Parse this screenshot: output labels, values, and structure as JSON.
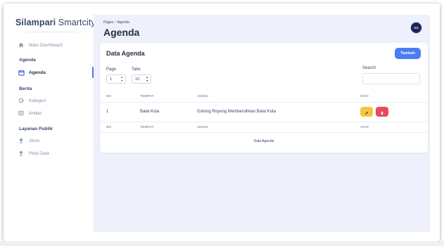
{
  "sidebar": {
    "brand_bold": "Silampari",
    "brand_rest": " Smartcity",
    "main_dashboard": "Main Dashboard",
    "sections": [
      {
        "heading": "Agenda",
        "items": [
          {
            "label": "Agenda",
            "icon": "calendar-icon",
            "active": true
          }
        ]
      },
      {
        "heading": "Berita",
        "items": [
          {
            "label": "Kategori",
            "icon": "tag-icon"
          },
          {
            "label": "Artikel",
            "icon": "article-icon"
          }
        ]
      },
      {
        "heading": "Layanan Publik",
        "items": [
          {
            "label": "Jenis",
            "icon": "map-pin-icon"
          },
          {
            "label": "Peta Data",
            "icon": "map-pin-icon"
          }
        ]
      }
    ]
  },
  "header": {
    "breadcrumb_parent": "Pages",
    "breadcrumb_sep": "/",
    "breadcrumb_current": "Agenda",
    "title": "Agenda",
    "avatar_initials": "AA"
  },
  "card": {
    "title": "Data Agenda",
    "add_button": "Tambah",
    "page_label": "Page",
    "page_value": "1",
    "take_label": "Take",
    "take_value": "10",
    "search_label": "Search",
    "search_value": "",
    "columns": [
      "NO",
      "TEMPAT",
      "JUDUL",
      "AKSI"
    ],
    "rows": [
      {
        "no": "1",
        "tempat": "Balai Kota",
        "judul": "Gotong Royong Membersihkan Balai Kota"
      }
    ],
    "caption": "Data Agenda"
  },
  "colors": {
    "accent": "#4c7cf4",
    "edit": "#f4c542",
    "delete": "#ea4a5a",
    "avatar": "#1b2458"
  }
}
